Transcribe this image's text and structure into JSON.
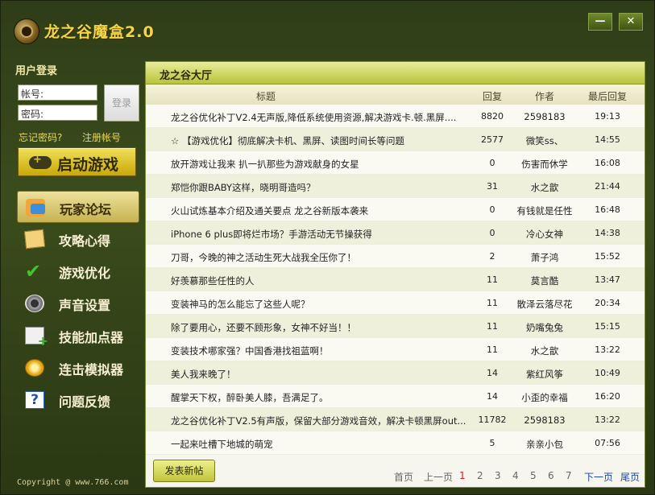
{
  "app": {
    "title": "龙之谷魔盒2.0",
    "minimize": "—",
    "close": "✕"
  },
  "login": {
    "title": "用户登录",
    "username_value": "帐号:",
    "password_value": "密码:",
    "login_button": "登录",
    "forgot": "忘记密码?",
    "register": "注册帐号"
  },
  "start_game": "启动游戏",
  "nav": [
    {
      "label": "玩家论坛",
      "icon": "forum-icon"
    },
    {
      "label": "攻略心得",
      "icon": "guide-icon"
    },
    {
      "label": "游戏优化",
      "icon": "check-icon"
    },
    {
      "label": "声音设置",
      "icon": "speaker-icon"
    },
    {
      "label": "技能加点器",
      "icon": "plugin-icon"
    },
    {
      "label": "连击模拟器",
      "icon": "clicker-icon"
    },
    {
      "label": "问题反馈",
      "icon": "help-icon"
    }
  ],
  "copyright": "Copyright @ www.766.com",
  "main": {
    "title": "龙之谷大厅",
    "columns": {
      "title": "标题",
      "replies": "回复",
      "author": "作者",
      "last_reply": "最后回复"
    },
    "rows": [
      {
        "title": "龙之谷优化补丁V2.4无声版,降低系统使用资源,解决游戏卡.顿.黑屏....",
        "replies": "8820",
        "author": "2598183",
        "last": "19:13"
      },
      {
        "title": "       ☆      【游戏优化】彻底解决卡机、黑屏、读图时间长等问题",
        "replies": "2577",
        "author": "微笑ss、",
        "last": "14:55"
      },
      {
        "title": "放开游戏让我来 扒一扒那些为游戏献身的女星",
        "replies": "0",
        "author": "伤害而休学",
        "last": "16:08"
      },
      {
        "title": "郑恺你跟BABY这样，晓明哥造吗？",
        "replies": "31",
        "author": "水之歆",
        "last": "21:44"
      },
      {
        "title": "火山试炼基本介绍及通关要点 龙之谷新版本袭来",
        "replies": "0",
        "author": "有钱就是任性",
        "last": "16:48"
      },
      {
        "title": "iPhone 6 plus即将烂市场？手游活动无节操获得",
        "replies": "0",
        "author": "冷心女神",
        "last": "14:38"
      },
      {
        "title": "刀哥，今晚的神之活动生死大战我全压你了！",
        "replies": "2",
        "author": "萧子鸿",
        "last": "15:52"
      },
      {
        "title": "好羡慕那些任性的人",
        "replies": "11",
        "author": "莫言酷",
        "last": "13:47"
      },
      {
        "title": "变装神马的怎么能忘了这些人呢？",
        "replies": "11",
        "author": "散泽云落尽花",
        "last": "20:34"
      },
      {
        "title": "除了要用心，还要不顾形象，女神不好当！！",
        "replies": "11",
        "author": "奶嘴兔兔",
        "last": "15:15"
      },
      {
        "title": "变装技术哪家强？中国香港找祖蓝啊！",
        "replies": "11",
        "author": "水之歆",
        "last": "13:22"
      },
      {
        "title": "美人我来晚了！",
        "replies": "14",
        "author": "紫红风筝",
        "last": "10:49"
      },
      {
        "title": "  醒掌天下权，醉卧美人膝，吾满足了。",
        "replies": "14",
        "author": "小歪的幸福",
        "last": "16:20"
      },
      {
        "title": "龙之谷优化补丁V2.5有声版，保留大部分游戏音效，解决卡顿黑屏out...",
        "replies": "11782",
        "author": "2598183",
        "last": "13:22"
      },
      {
        "title": "一起来吐槽下地城的萌宠",
        "replies": "5",
        "author": "亲亲小包",
        "last": "07:56"
      }
    ],
    "post_button": "发表新帖",
    "pager": {
      "first": "首页",
      "prev": "上一页",
      "pages": [
        "1",
        "2",
        "3",
        "4",
        "5",
        "6",
        "7"
      ],
      "current": "1",
      "next": "下一页",
      "last": "尾页"
    }
  }
}
